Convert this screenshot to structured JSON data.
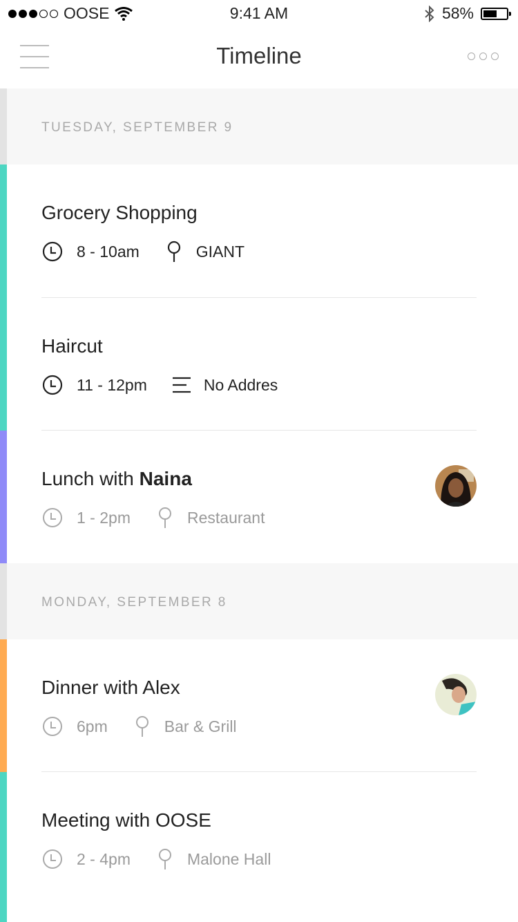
{
  "status_bar": {
    "carrier": "OOSE",
    "time": "9:41 AM",
    "battery": "58%",
    "battery_level": 0.58
  },
  "nav": {
    "title": "Timeline"
  },
  "days": [
    {
      "label": "TUESDAY, SEPTEMBER 9",
      "events": [
        {
          "title": "Grocery Shopping",
          "time": "8 - 10am",
          "location": "GIANT",
          "location_icon": "map-pin-icon",
          "color": "#4dd6c2"
        },
        {
          "title": "Haircut",
          "time": "11 - 12pm",
          "location": "No Addres",
          "location_icon": "notes-icon",
          "color": "#4dd6c2"
        },
        {
          "title_prefix": "Lunch with ",
          "title_bold": "Naina",
          "time": "1 - 2pm",
          "location": "Restaurant",
          "location_icon": "map-pin-icon",
          "color": "#8f8af8",
          "avatar": true
        }
      ]
    },
    {
      "label": "MONDAY, SEPTEMBER 8",
      "events": [
        {
          "title": "Dinner with Alex",
          "time": "6pm",
          "location": "Bar & Grill",
          "location_icon": "map-pin-icon",
          "color": "#ffab52",
          "avatar": true
        },
        {
          "title": "Meeting with OOSE",
          "time": "2 - 4pm",
          "location": "Malone Hall",
          "location_icon": "map-pin-icon",
          "color": "#4dd6c2"
        }
      ]
    }
  ]
}
